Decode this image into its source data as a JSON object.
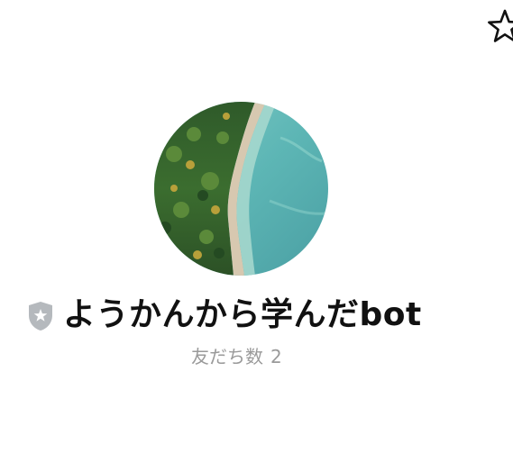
{
  "header": {
    "favorite_icon": "star-outline-icon"
  },
  "profile": {
    "avatar_icon": "avatar-forest-coast",
    "badge_icon": "shield-star-icon",
    "name": "ようかんから学んだbot",
    "friends_label": "友だち数",
    "friends_count": "2"
  },
  "colors": {
    "name_text": "#111111",
    "muted_text": "#9a9a9a",
    "badge": "#b5b9bd",
    "sea": "#5db5b4"
  }
}
